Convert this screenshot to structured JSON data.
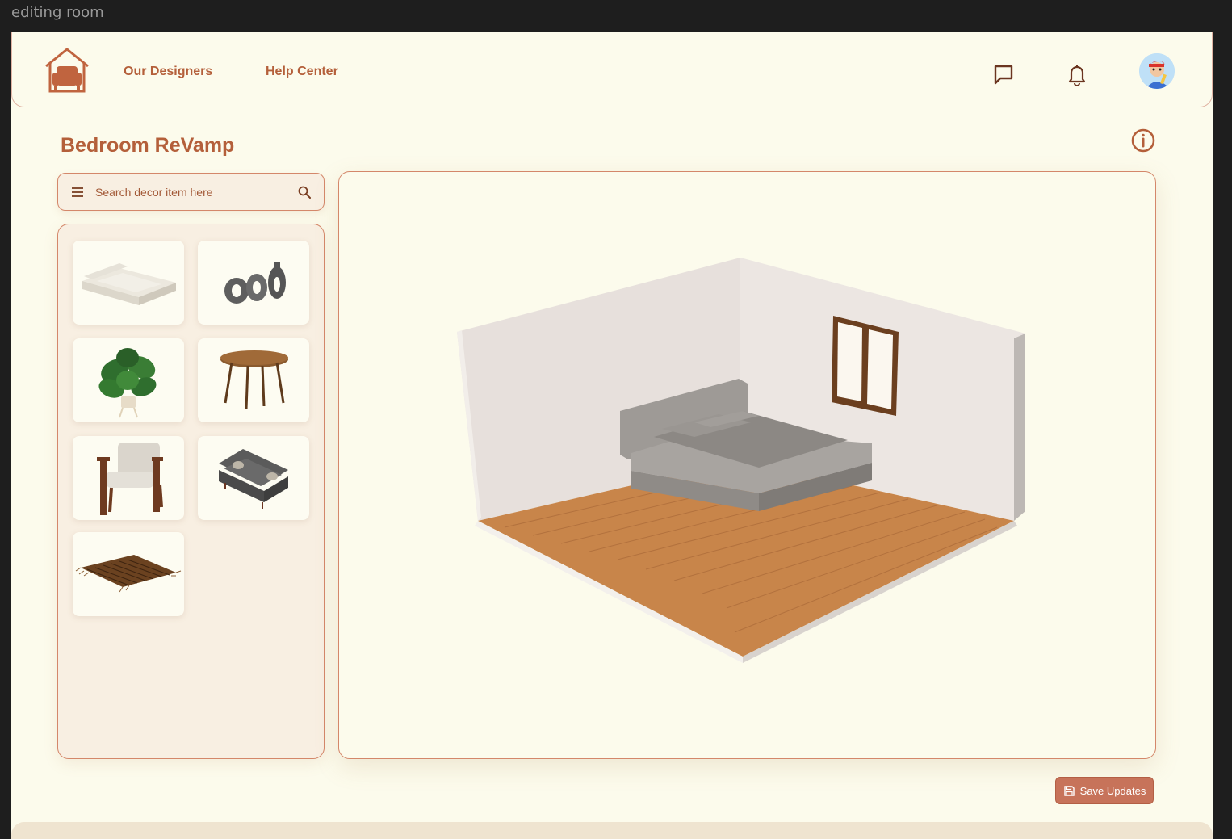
{
  "window": {
    "title": "editing room"
  },
  "header": {
    "nav": [
      {
        "label": "Our Designers"
      },
      {
        "label": "Help Center"
      }
    ]
  },
  "page": {
    "title": "Bedroom ReVamp"
  },
  "search": {
    "placeholder": "Search decor item here",
    "value": ""
  },
  "decor_items": [
    {
      "name": "tufted-bed"
    },
    {
      "name": "vases"
    },
    {
      "name": "monstera-plant"
    },
    {
      "name": "round-wood-table"
    },
    {
      "name": "armchair"
    },
    {
      "name": "grey-sofa"
    },
    {
      "name": "rug"
    }
  ],
  "actions": {
    "save_label": "Save Updates"
  },
  "colors": {
    "accent": "#b45f3a",
    "border": "#d4876a",
    "background": "#fcfbec",
    "panel": "#f8efe2",
    "button": "#c7735a"
  }
}
